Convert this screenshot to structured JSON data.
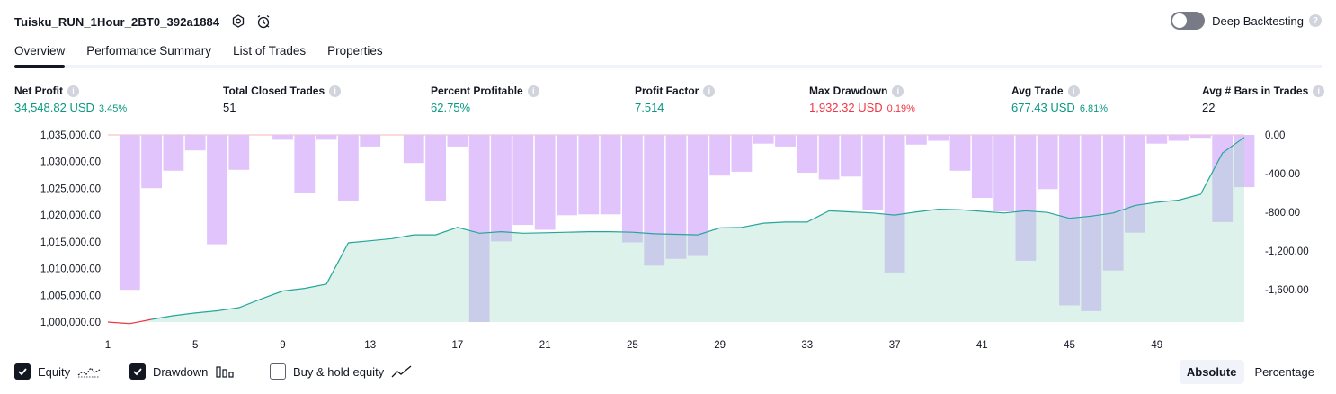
{
  "header": {
    "strategy_name": "Tuisku_RUN_1Hour_2BT0_392a1884",
    "icons": [
      "settings-icon",
      "alert-clock-icon"
    ]
  },
  "deep_backtesting": {
    "label": "Deep Backtesting",
    "enabled": false
  },
  "tabs": [
    {
      "label": "Overview",
      "active": true
    },
    {
      "label": "Performance Summary",
      "active": false
    },
    {
      "label": "List of Trades",
      "active": false
    },
    {
      "label": "Properties",
      "active": false
    }
  ],
  "metrics": {
    "net_profit": {
      "label": "Net Profit",
      "value": "34,548.82 USD",
      "pct": "3.45%"
    },
    "total_closed_trades": {
      "label": "Total Closed Trades",
      "value": "51"
    },
    "percent_profitable": {
      "label": "Percent Profitable",
      "value": "62.75%"
    },
    "profit_factor": {
      "label": "Profit Factor",
      "value": "7.514"
    },
    "max_drawdown": {
      "label": "Max Drawdown",
      "value": "1,932.32 USD",
      "pct": "0.19%"
    },
    "avg_trade": {
      "label": "Avg Trade",
      "value": "677.43 USD",
      "pct": "6.81%"
    },
    "avg_bars": {
      "label": "Avg # Bars in Trades",
      "value": "22"
    }
  },
  "colors": {
    "equity_line": "#26a69a",
    "equity_negative": "#f23645",
    "equity_fill": "#dcf2ec",
    "drawdown_bar": "#e1c4fc",
    "drawdown_overlap": "#c4b8f0",
    "green": "#089981",
    "red": "#f23645"
  },
  "chart_data": {
    "type": "area",
    "x_ticks": [
      1,
      5,
      9,
      13,
      17,
      21,
      25,
      29,
      33,
      37,
      41,
      45,
      49
    ],
    "y_left": {
      "ticks": [
        "1,000,000.00",
        "1,005,000.00",
        "1,010,000.00",
        "1,015,000.00",
        "1,020,000.00",
        "1,025,000.00",
        "1,030,000.00",
        "1,035,000.00"
      ],
      "range": [
        1000000,
        1035000
      ]
    },
    "y_right": {
      "ticks": [
        "0.00",
        "-400.00",
        "-800.00",
        "-1,200.00",
        "-1,600.00"
      ],
      "range": [
        -1932.32,
        0
      ]
    },
    "series": [
      {
        "name": "Equity",
        "values": [
          1000000,
          999700,
          1000500,
          1001200,
          1001700,
          1002100,
          1002700,
          1004300,
          1005800,
          1006300,
          1007100,
          1014800,
          1015200,
          1015600,
          1016300,
          1016300,
          1017700,
          1016600,
          1016900,
          1016600,
          1016700,
          1016800,
          1016900,
          1016900,
          1016800,
          1016500,
          1016400,
          1016300,
          1017600,
          1017700,
          1018500,
          1018700,
          1018700,
          1020800,
          1020600,
          1020400,
          1020000,
          1020600,
          1021100,
          1021000,
          1020700,
          1020400,
          1020800,
          1020500,
          1019400,
          1019800,
          1020400,
          1021800,
          1022400,
          1022800,
          1023900,
          1031600,
          1034548.82
        ]
      },
      {
        "name": "Drawdown",
        "values": [
          0,
          -1600,
          -550,
          -370,
          -160,
          -1130,
          -360,
          0,
          -50,
          -600,
          -50,
          -680,
          -120,
          0,
          -290,
          -680,
          -120,
          -1932.32,
          -1100,
          -930,
          -980,
          -830,
          -820,
          -820,
          -1110,
          -1350,
          -1280,
          -1250,
          -420,
          -380,
          -90,
          -120,
          -390,
          -460,
          -430,
          -780,
          -1420,
          -100,
          -60,
          -370,
          -650,
          -790,
          -1300,
          -560,
          -1760,
          -1820,
          -1400,
          -1010,
          -90,
          -60,
          -30,
          -900,
          -540
        ]
      }
    ]
  },
  "footer": {
    "legend": [
      {
        "label": "Equity",
        "checked": true,
        "icon": "equity-line-icon"
      },
      {
        "label": "Drawdown",
        "checked": true,
        "icon": "drawdown-bars-icon"
      },
      {
        "label": "Buy & hold equity",
        "checked": false,
        "icon": "buy-hold-line-icon"
      }
    ],
    "modes": [
      {
        "label": "Absolute",
        "active": true
      },
      {
        "label": "Percentage",
        "active": false
      }
    ]
  }
}
